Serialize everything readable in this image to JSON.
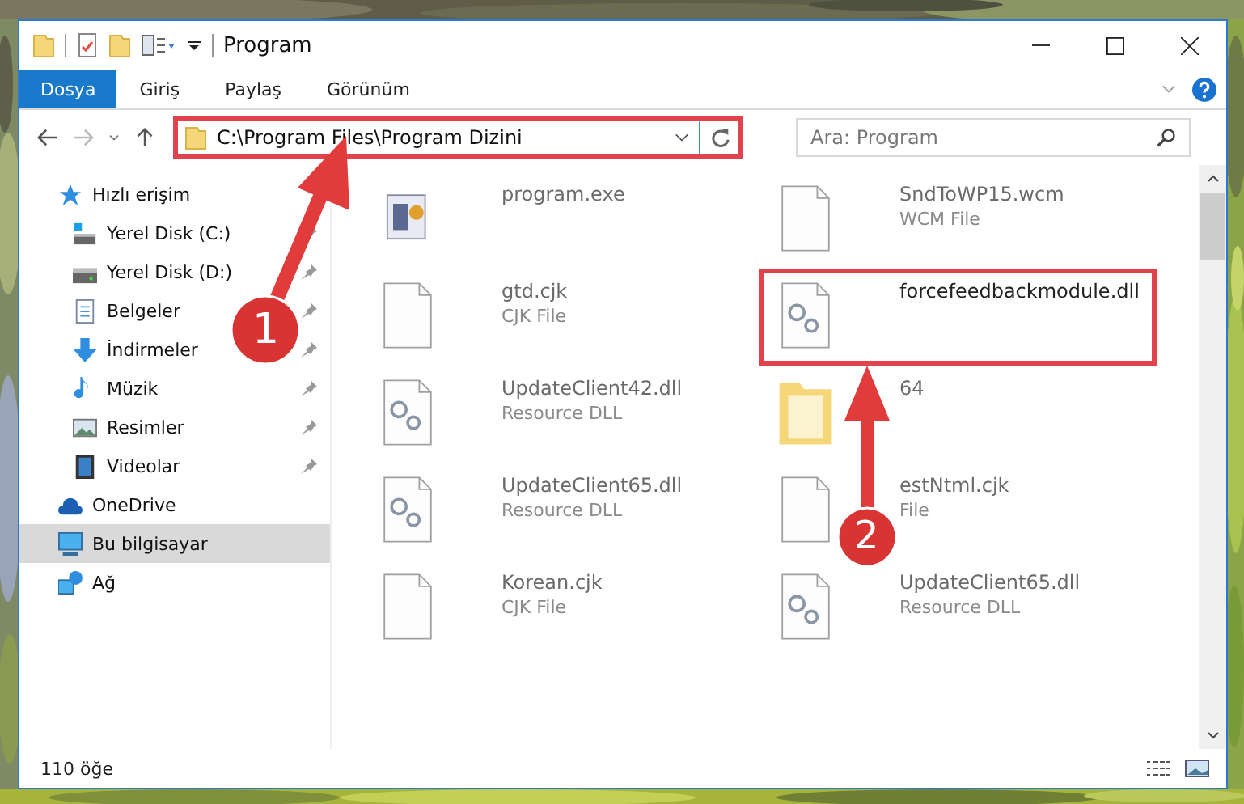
{
  "window": {
    "title": "Program"
  },
  "ribbon_tabs": [
    {
      "label": "Dosya",
      "selected": true
    },
    {
      "label": "Giriş",
      "selected": false
    },
    {
      "label": "Paylaş",
      "selected": false
    },
    {
      "label": "Görünüm",
      "selected": false
    }
  ],
  "address": {
    "path": "C:\\Program Files\\Program Dizini",
    "highlighted": true
  },
  "search": {
    "placeholder": "Ara: Program"
  },
  "sidebar": {
    "items": [
      {
        "label": "Hızlı erişim",
        "pinned": false,
        "selected": false,
        "children": [
          {
            "label": "Yerel Disk (C:)",
            "pinned": true,
            "selected": false
          },
          {
            "label": "Yerel Disk (D:)",
            "pinned": true,
            "selected": false
          },
          {
            "label": "Belgeler",
            "pinned": true,
            "selected": false
          },
          {
            "label": "İndirmeler",
            "pinned": true,
            "selected": false
          },
          {
            "label": "Müzik",
            "pinned": true,
            "selected": false
          },
          {
            "label": "Resimler",
            "pinned": true,
            "selected": false
          },
          {
            "label": "Videolar",
            "pinned": true,
            "selected": false
          }
        ]
      },
      {
        "label": "OneDrive",
        "pinned": false,
        "selected": false
      },
      {
        "label": "Bu bilgisayar",
        "pinned": false,
        "selected": true
      },
      {
        "label": "Ağ",
        "pinned": false,
        "selected": false
      }
    ]
  },
  "files": [
    {
      "name": "program.exe",
      "kind": "program",
      "highlighted": false
    },
    {
      "name": "SndToWP15.wcm",
      "type": "WCM File",
      "kind": "file",
      "highlighted": false
    },
    {
      "name": "gtd.cjk",
      "type": "CJK File",
      "kind": "file",
      "highlighted": false
    },
    {
      "name": "forcefeedbackmodule.dll",
      "kind": "dll",
      "highlighted": true
    },
    {
      "name": "UpdateClient42.dll",
      "type": "Resource DLL",
      "kind": "dll",
      "highlighted": false
    },
    {
      "name": "64",
      "kind": "folder",
      "highlighted": false
    },
    {
      "name": "UpdateClient65.dll",
      "type": "Resource DLL",
      "kind": "dll",
      "highlighted": false
    },
    {
      "name": "estNtml.cjk",
      "type": "File",
      "kind": "file",
      "highlighted": false
    },
    {
      "name": "Korean.cjk",
      "type": "CJK File",
      "kind": "file",
      "highlighted": false
    },
    {
      "name": "UpdateClient65.dll",
      "type": "Resource DLL",
      "kind": "dll",
      "highlighted": false
    }
  ],
  "callouts": [
    {
      "number": "1"
    },
    {
      "number": "2"
    }
  ],
  "status_bar": {
    "count": "110 öğe"
  }
}
